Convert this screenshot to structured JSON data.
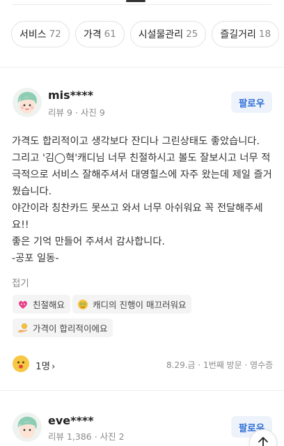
{
  "filters": [
    {
      "label": "서비스",
      "count": "72"
    },
    {
      "label": "가격",
      "count": "61"
    },
    {
      "label": "시설물관리",
      "count": "25"
    },
    {
      "label": "즐길거리",
      "count": "18"
    },
    {
      "label": "",
      "count": ""
    }
  ],
  "reviews": [
    {
      "username": "mis****",
      "meta": "리뷰 9 · 사진 9",
      "follow_label": "팔로우",
      "body": [
        "가격도 합리적이고 생각보다 잔디나 그린상태도 좋았습니다.",
        "그리고 '김◯혁'캐디님 너무 친절하시고 볼도 잘보시고 너무 적",
        "극적으로 서비스 잘해주셔서 대영힐스에 자주 왔는데 제일 즐거",
        "웠습니다.",
        "야간이라 칭찬카드 못쓰고 와서 너무 아쉬워요 꼭 전달해주세",
        "요!!",
        "좋은 기억 만들어 주셔서 감사합니다.",
        "-공포 일동-"
      ],
      "fold_label": "접기",
      "tags": [
        {
          "icon": "heart-face-icon",
          "label": "친절해요"
        },
        {
          "icon": "money-face-icon",
          "label": "캐디의 진행이 매끄러워요"
        },
        {
          "icon": "coin-hand-icon",
          "label": "가격이 합리적이에요"
        }
      ],
      "reaction_count": "1명",
      "visit_meta": "8.29.금 · 1번째 방문 · 영수증"
    },
    {
      "username": "eve****",
      "meta": "리뷰 1,386 · 사진 2",
      "follow_label": "팔로우"
    }
  ],
  "colors": {
    "accent": "#2f6fd6",
    "follow_bg": "#eef3fb"
  }
}
